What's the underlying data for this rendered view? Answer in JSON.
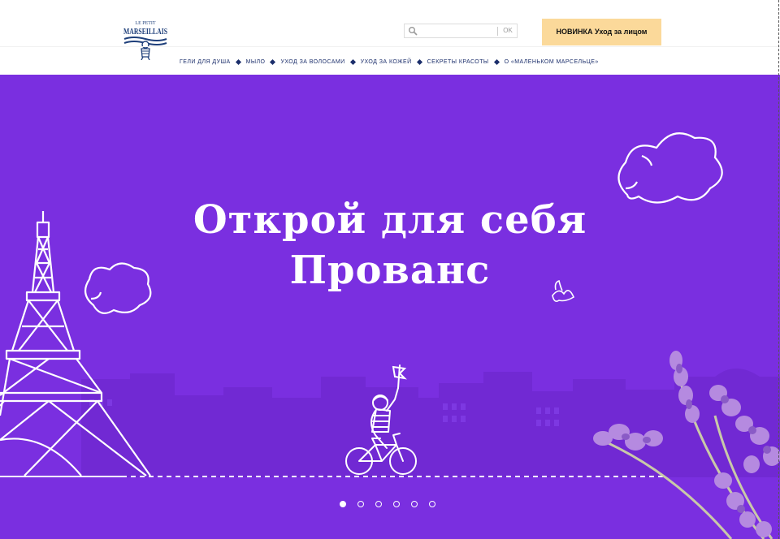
{
  "brand": {
    "logo_line1": "LE PETIT",
    "logo_line2": "MARSEILLAIS"
  },
  "search": {
    "placeholder": "",
    "button_label": "OK"
  },
  "promo_button": "НОВИНКА Уход за лицом",
  "nav": [
    "ГЕЛИ ДЛЯ ДУША",
    "МЫЛО",
    "УХОД ЗА ВОЛОСАМИ",
    "УХОД ЗА КОЖЕЙ",
    "СЕКРЕТЫ КРАСОТЫ",
    "О «МАЛЕНЬКОМ МАРСЕЛЬЦЕ»"
  ],
  "hero": {
    "headline_line1": "Открой для себя",
    "headline_line2": "Прованс",
    "background": "#7a2fe0"
  },
  "carousel": {
    "slides": 6,
    "active_index": 0
  },
  "icons": [
    "search-icon",
    "bird-icon",
    "flag-icon",
    "bicycle-icon",
    "eiffel-tower-icon",
    "cloud-icon",
    "lavender-icon"
  ],
  "colors": {
    "accent": "#fbd99a",
    "nav_text": "#1b2e6b",
    "hero": "#7a2fe0"
  }
}
